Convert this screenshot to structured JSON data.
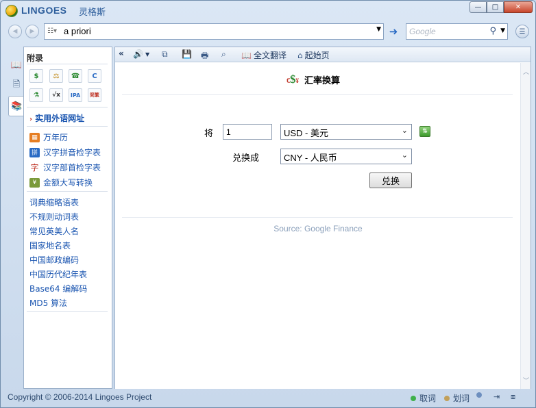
{
  "window": {
    "brand": "LINGOES",
    "brand_cn": "灵格斯",
    "btn_minimize": "—",
    "btn_restore": "□",
    "btn_close": "✕"
  },
  "search": {
    "query": "a priori",
    "google_placeholder": "Google"
  },
  "left_panel": {
    "title": "附录",
    "tools": [
      "$",
      "⚖",
      "☎",
      "C",
      "⚗",
      "√x",
      "IPA",
      "简繁"
    ],
    "section_header": "实用外语网址",
    "icon_links": [
      {
        "label": "万年历",
        "icon": "calendar-icon"
      },
      {
        "label": "汉字拼音检字表",
        "icon": "pinyin-icon"
      },
      {
        "label": "汉字部首检字表",
        "icon": "radical-icon"
      },
      {
        "label": "金额大写转换",
        "icon": "money-icon"
      }
    ],
    "links": [
      "词典缩略语表",
      "不规则动词表",
      "常见英美人名",
      "国家地名表",
      "中国邮政编码",
      "中国历代纪年表",
      "Base64 编解码",
      "MD5 算法"
    ]
  },
  "main_toolbar": {
    "collapse": "«",
    "fulltext_translate": "全文翻译",
    "home": "起始页"
  },
  "converter": {
    "title": "汇率换算",
    "amount_label": "将",
    "amount_value": "1",
    "from_currency": "USD - 美元",
    "to_label": "兑换成",
    "to_currency": "CNY - 人民币",
    "convert_button": "兑换",
    "source": "Source: Google Finance"
  },
  "status": {
    "copyright": "Copyright © 2006-2014 Lingoes Project",
    "pick_word": "取词",
    "select_word": "划词",
    "pick_color": "#3fb04a",
    "select_color": "#c2a05a"
  }
}
